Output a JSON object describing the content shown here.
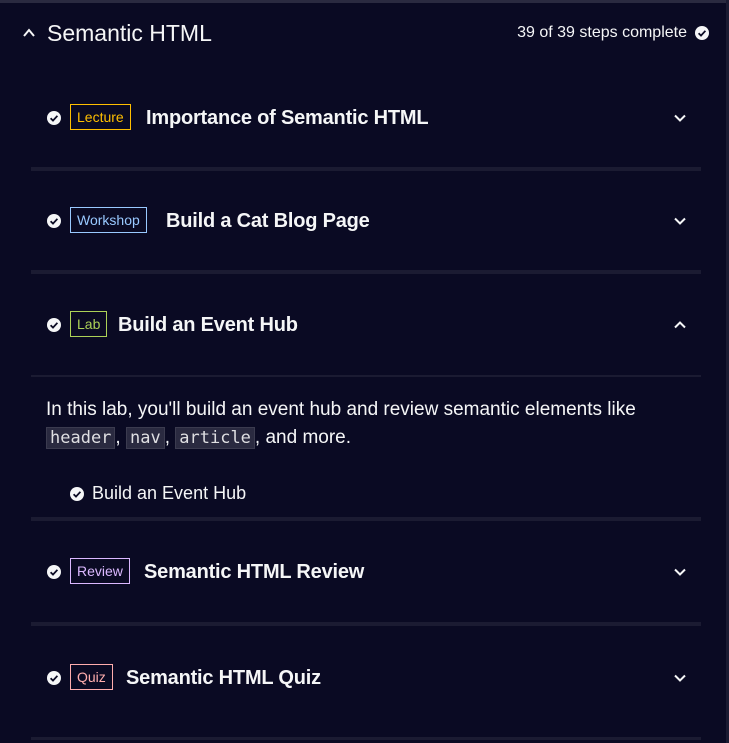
{
  "block": {
    "title": "Semantic HTML",
    "progress": "39 of 39 steps complete",
    "caret_icon": "chevron-up-icon"
  },
  "rows": [
    {
      "tag": "Lecture",
      "title": "Importance of Semantic HTML",
      "expanded": false
    },
    {
      "tag": "Workshop",
      "title": "Build a Cat Blog Page",
      "expanded": false
    },
    {
      "tag": "Lab",
      "title": "Build an Event Hub",
      "expanded": true
    },
    {
      "tag": "Review",
      "title": "Semantic HTML Review",
      "expanded": false
    },
    {
      "tag": "Quiz",
      "title": "Semantic HTML Quiz",
      "expanded": false
    }
  ],
  "lab_detail": {
    "text_before": "In this lab, you'll build an event hub and review semantic elements like ",
    "code1": "header",
    "sep1": ", ",
    "code2": "nav",
    "sep2": ", ",
    "code3": "article",
    "text_after": ", and more.",
    "step_label": "Build an Event Hub"
  },
  "colors": {
    "background": "#0a0a23",
    "lecture": "#ffbf00",
    "workshop": "#99c9ff",
    "lab": "#acd157",
    "review": "#dbb8ff",
    "quiz": "#ffadad"
  }
}
